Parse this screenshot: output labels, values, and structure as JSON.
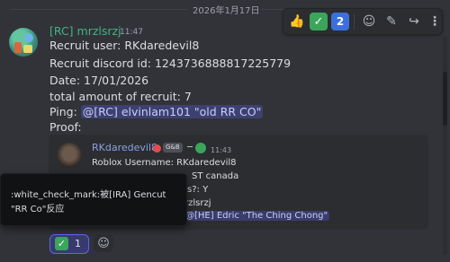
{
  "date_divider": "2026年1月17日",
  "toolbar": {
    "reaction_1_icon": "thumbs-up-icon",
    "reaction_1_glyph": "👍",
    "reaction_2_icon": "check-mark-icon",
    "reaction_2_glyph": "✓",
    "reaction_3_icon": "keycap-two-icon",
    "reaction_3_glyph": "2",
    "add_reaction_icon": "smiley-icon",
    "add_reaction_glyph": "☺",
    "edit_icon": "pencil-icon",
    "edit_glyph": "✎",
    "forward_icon": "forward-arrow-icon",
    "forward_glyph": "↪",
    "more_icon": "more-icon",
    "more_glyph": "⋮"
  },
  "message": {
    "author": "[RC] mrzlsrzj",
    "time": "11:47",
    "lines": [
      "Recruit user: RKdaredevil8",
      "Recruit discord id: 1243736888817225779",
      "Date:  17/01/2026",
      "total amount of recruit: 7"
    ],
    "ping_label": "Ping:",
    "ping_mention": "@[RC] elvinlam101 \"old RR CO\"",
    "proof_label": "Proof:"
  },
  "embed": {
    "author": "RKdaredevil8",
    "tag": "G&B",
    "time": "11:43",
    "lines": [
      "Roblox Username: RKdaredevil8",
      "ST canada",
      "s?: Y",
      "rzlsrzj"
    ],
    "mention": "@[HE] Edric \"The Ching Chong\""
  },
  "popup": {
    "line1": ":white_check_mark:被[IRA] Gencut",
    "line2": "\"RR Co\"反应"
  },
  "reactions": {
    "glyph": "✓",
    "count": "1",
    "add_icon": "smiley-icon",
    "add_glyph": "☺"
  },
  "colors": {
    "background": "#323339",
    "author_green": "#43b581",
    "mention_bg": "#5865f2",
    "embed_author": "#8ea1e1"
  }
}
